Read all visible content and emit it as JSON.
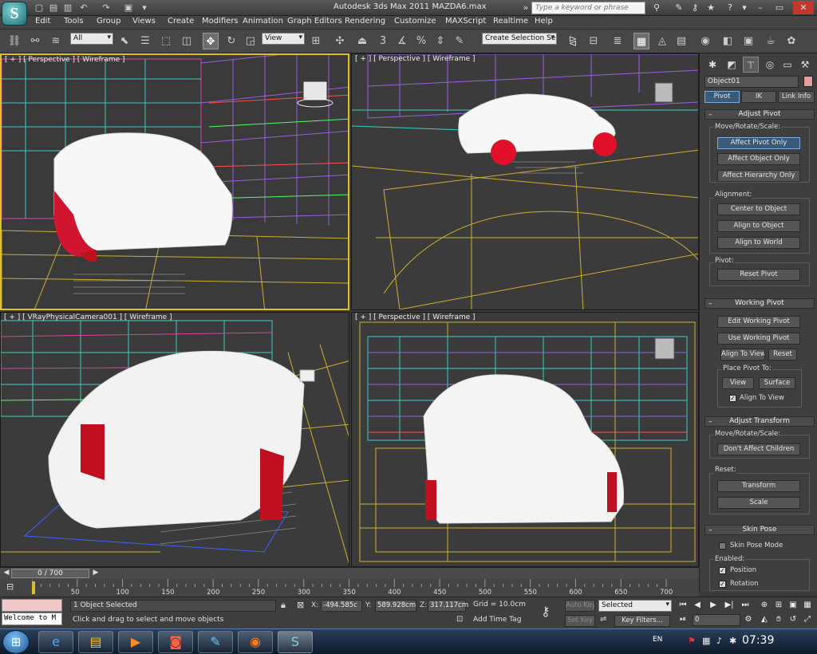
{
  "titlebar": {
    "title": "Autodesk 3ds Max  2011     MAZDA6.max",
    "search_placeholder": "Type a keyword or phrase"
  },
  "menus": [
    "Edit",
    "Tools",
    "Group",
    "Views",
    "Create",
    "Modifiers",
    "Animation",
    "Graph Editors",
    "Rendering",
    "Customize",
    "MAXScript",
    "Realtime",
    "Help"
  ],
  "toolbar": {
    "selection_filter": "All",
    "reference_coord": "View",
    "named_selection": "Create Selection Se"
  },
  "viewports": {
    "top_left": "[ + ] [ Perspective ] [ Wireframe ]",
    "top_right": "[ + ] [ Perspective ] [ Wireframe ]",
    "bottom_left": "[ + ] [ VRayPhysicalCamera001 ] [ Wireframe ]",
    "bottom_right": "[ + ] [ Perspective ] [ Wireframe ]"
  },
  "command_panel": {
    "object_name": "Object01",
    "object_color": "#e0a0a0",
    "tabs": [
      "Pivot",
      "IK",
      "Link Info"
    ],
    "adjust_pivot": {
      "title": "Adjust Pivot",
      "move_group": "Move/Rotate/Scale:",
      "affect_pivot": "Affect Pivot Only",
      "affect_object": "Affect Object Only",
      "affect_hierarchy": "Affect Hierarchy Only",
      "alignment_group": "Alignment:",
      "center_to_object": "Center to Object",
      "align_to_object": "Align to Object",
      "align_to_world": "Align to World",
      "pivot_group": "Pivot:",
      "reset_pivot": "Reset Pivot"
    },
    "working_pivot": {
      "title": "Working Pivot",
      "edit": "Edit Working Pivot",
      "use": "Use Working Pivot",
      "align_to_view": "Align To View",
      "reset": "Reset",
      "place_group": "Place Pivot To:",
      "view": "View",
      "surface": "Surface",
      "align_to_view_chk": "Align To View"
    },
    "adjust_transform": {
      "title": "Adjust Transform",
      "move_group": "Move/Rotate/Scale:",
      "dont_affect": "Don't Affect Children",
      "reset_group": "Reset:",
      "transform": "Transform",
      "scale": "Scale"
    },
    "skin_pose": {
      "title": "Skin Pose",
      "mode": "Skin Pose Mode",
      "enabled_group": "Enabled:",
      "position": "Position",
      "rotation": "Rotation"
    }
  },
  "timeline": {
    "frame_counter": "0 / 700",
    "ticks": [
      "0",
      "50",
      "100",
      "150",
      "200",
      "250",
      "300",
      "350",
      "400",
      "450",
      "500",
      "550",
      "600",
      "650",
      "700"
    ]
  },
  "status": {
    "selected": "1 Object Selected",
    "prompt": "Click and drag to select and move objects",
    "x": "-494.585c",
    "y": "589.928cm",
    "z": "317.117cm",
    "grid": "Grid = 10.0cm",
    "add_time_tag": "Add Time Tag",
    "auto_key": "Auto Key",
    "set_key": "Set Key",
    "key_mode": "Selected",
    "key_filters": "Key Filters...",
    "current_frame": "0",
    "maxscript": "Welcome to M"
  },
  "taskbar": {
    "lang": "EN",
    "clock": "07:39"
  }
}
